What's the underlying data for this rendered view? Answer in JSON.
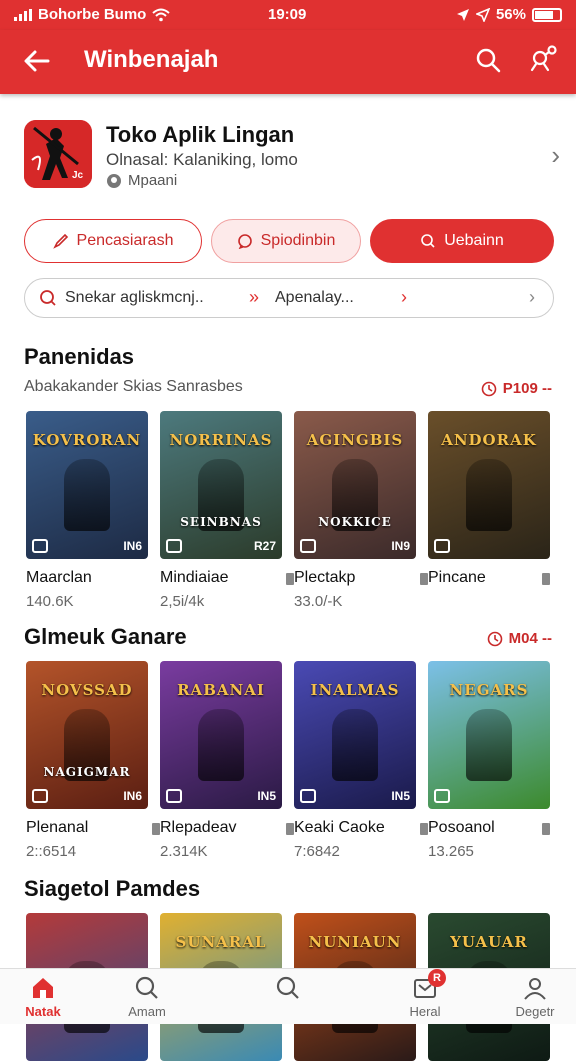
{
  "status": {
    "carrier": "Bohorbe Bumo",
    "time": "19:09",
    "battery": "56%"
  },
  "appbar": {
    "title": "Winbenajah"
  },
  "store": {
    "name": "Toko Aplik Lingan",
    "subtitle": "Olnasal: Kalaniking, lomo",
    "location": "Mpaani"
  },
  "chips": [
    "Pencasiarash",
    "Spiodinbin",
    "Uebainn"
  ],
  "searchbar": {
    "text1": "Snekar agliskmcnj..",
    "text2": "Apenalay..."
  },
  "sections": [
    {
      "title": "Panenidas",
      "subtitle": "Abakakander Skias Sanrasbes",
      "more": "P109 --",
      "cards": [
        {
          "name": "Maarclan",
          "meta": "140.6K",
          "banner": "KOVRORAN",
          "corner": "IN6",
          "colors": [
            "#1d2a44",
            "#3a5d8a"
          ]
        },
        {
          "name": "Mindiaiae",
          "meta": "2,5i/4k",
          "banner": "NORRINAS",
          "banner2": "SEINBNAS",
          "corner": "R27",
          "colors": [
            "#2b3b2a",
            "#4d7a7e"
          ]
        },
        {
          "name": "Plectakp",
          "meta": "33.0/-K",
          "banner": "AGINGBIS",
          "banner2": "NOKKICE",
          "corner": "IN9",
          "colors": [
            "#3b2a2a",
            "#8a5a4a"
          ]
        },
        {
          "name": "Pincane",
          "meta": "",
          "banner": "ANDORAK",
          "corner": "",
          "colors": [
            "#2a2418",
            "#6a4f2a"
          ]
        }
      ]
    },
    {
      "title": "Glmeuk Ganare",
      "subtitle": "",
      "more": "M04 --",
      "cards": [
        {
          "name": "Plenanal",
          "meta": "2::6514",
          "banner": "NOVSSAD",
          "banner2": "NAGIGMAR",
          "corner": "IN6",
          "colors": [
            "#5a1e12",
            "#b4542a"
          ]
        },
        {
          "name": "Rlepadeav",
          "meta": "2.314K",
          "banner": "RABANAI",
          "corner": "IN5",
          "colors": [
            "#2a1a44",
            "#7a3ca0"
          ]
        },
        {
          "name": "Keaki Caoke",
          "meta": "7:6842",
          "banner": "INALMAS",
          "corner": "IN5",
          "colors": [
            "#1a1a4a",
            "#4a4ab4"
          ]
        },
        {
          "name": "Posoanol",
          "meta": "13.265",
          "banner": "NEGARS",
          "corner": "",
          "colors": [
            "#3c8a2c",
            "#7cc0e8"
          ]
        }
      ]
    },
    {
      "title": "Siagetol Pamdes",
      "subtitle": "",
      "more": "",
      "cards": [
        {
          "name": "",
          "meta": "",
          "banner": "",
          "corner": "",
          "colors": [
            "#2a4a8a",
            "#b43a3a"
          ]
        },
        {
          "name": "",
          "meta": "",
          "banner": "SUNARAL",
          "corner": "",
          "colors": [
            "#3a8ab4",
            "#e0b030"
          ]
        },
        {
          "name": "",
          "meta": "",
          "banner": "NUNIAUN",
          "corner": "",
          "colors": [
            "#2a1a18",
            "#c0501a"
          ]
        },
        {
          "name": "",
          "meta": "",
          "banner": "YUAUAR",
          "corner": "",
          "colors": [
            "#0e1a14",
            "#2a4a30"
          ]
        }
      ]
    }
  ],
  "tabs": [
    {
      "label": "Natak",
      "icon": "home-icon"
    },
    {
      "label": "Amam",
      "icon": "search-icon"
    },
    {
      "label": "",
      "icon": "search-icon"
    },
    {
      "label": "Heral",
      "icon": "inbox-icon",
      "badge": "R"
    },
    {
      "label": "Degetr",
      "icon": "profile-icon"
    }
  ],
  "colors": {
    "accent": "#e03131"
  }
}
